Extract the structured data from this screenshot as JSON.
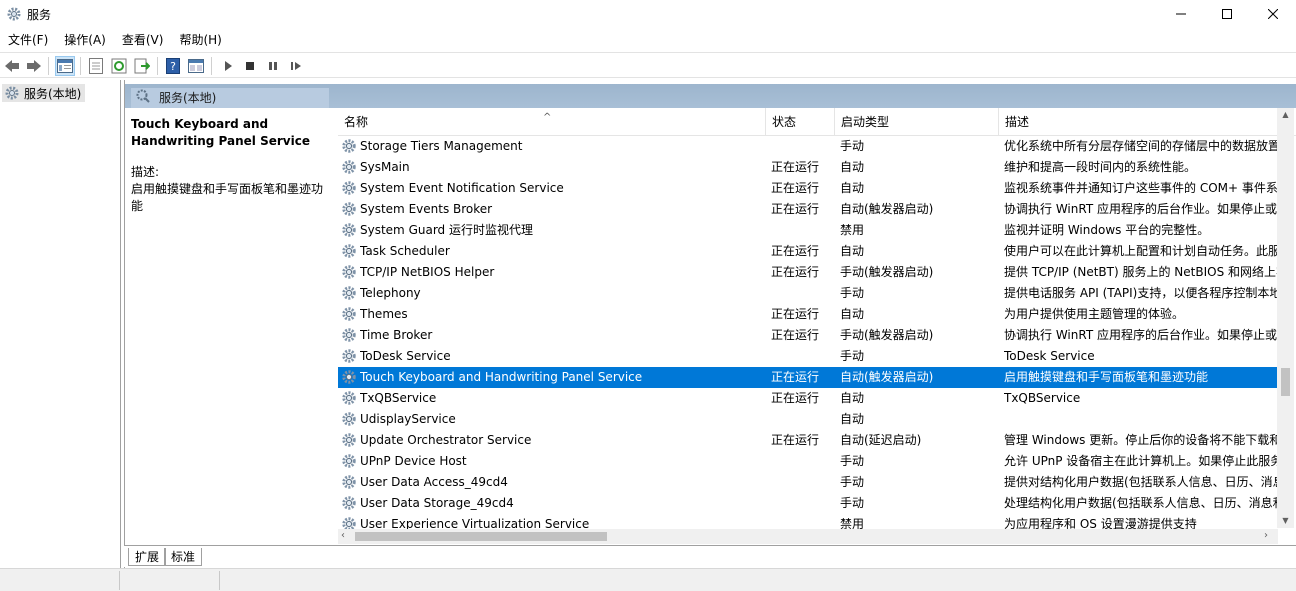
{
  "window": {
    "title": "服务"
  },
  "menu": [
    "文件(F)",
    "操作(A)",
    "查看(V)",
    "帮助(H)"
  ],
  "tree": {
    "root": "服务(本地)"
  },
  "panel": {
    "header": "服务(本地)"
  },
  "details": {
    "service_name": "Touch Keyboard and Handwriting Panel Service",
    "description_label": "描述:",
    "description": "启用触摸键盘和手写面板笔和墨迹功能"
  },
  "columns": {
    "name": "名称",
    "status": "状态",
    "startup": "启动类型",
    "description": "描述"
  },
  "services": [
    {
      "name": "Storage Tiers Management",
      "status": "",
      "startup": "手动",
      "description": "优化系统中所有分层存储空间的存储层中的数据放置"
    },
    {
      "name": "SysMain",
      "status": "正在运行",
      "startup": "自动",
      "description": "维护和提高一段时间内的系统性能。"
    },
    {
      "name": "System Event Notification Service",
      "status": "正在运行",
      "startup": "自动",
      "description": "监视系统事件并通知订户这些事件的 COM+ 事件系"
    },
    {
      "name": "System Events Broker",
      "status": "正在运行",
      "startup": "自动(触发器启动)",
      "description": "协调执行 WinRT 应用程序的后台作业。如果停止或"
    },
    {
      "name": "System Guard 运行时监视代理",
      "status": "",
      "startup": "禁用",
      "description": "监视并证明 Windows 平台的完整性。"
    },
    {
      "name": "Task Scheduler",
      "status": "正在运行",
      "startup": "自动",
      "description": "使用户可以在此计算机上配置和计划自动任务。此服"
    },
    {
      "name": "TCP/IP NetBIOS Helper",
      "status": "正在运行",
      "startup": "手动(触发器启动)",
      "description": "提供 TCP/IP (NetBT) 服务上的 NetBIOS 和网络上客"
    },
    {
      "name": "Telephony",
      "status": "",
      "startup": "手动",
      "description": "提供电话服务 API (TAPI)支持，以便各程序控制本地"
    },
    {
      "name": "Themes",
      "status": "正在运行",
      "startup": "自动",
      "description": "为用户提供使用主题管理的体验。"
    },
    {
      "name": "Time Broker",
      "status": "正在运行",
      "startup": "手动(触发器启动)",
      "description": "协调执行 WinRT 应用程序的后台作业。如果停止或"
    },
    {
      "name": "ToDesk Service",
      "status": "",
      "startup": "手动",
      "description": "ToDesk Service"
    },
    {
      "name": "Touch Keyboard and Handwriting Panel Service",
      "status": "正在运行",
      "startup": "自动(触发器启动)",
      "description": "启用触摸键盘和手写面板笔和墨迹功能",
      "selected": true
    },
    {
      "name": "TxQBService",
      "status": "正在运行",
      "startup": "自动",
      "description": "TxQBService"
    },
    {
      "name": "UdisplayService",
      "status": "",
      "startup": "自动",
      "description": ""
    },
    {
      "name": "Update Orchestrator Service",
      "status": "正在运行",
      "startup": "自动(延迟启动)",
      "description": "管理 Windows 更新。停止后你的设备将不能下载和"
    },
    {
      "name": "UPnP Device Host",
      "status": "",
      "startup": "手动",
      "description": "允许 UPnP 设备宿主在此计算机上。如果停止此服务"
    },
    {
      "name": "User Data Access_49cd4",
      "status": "",
      "startup": "手动",
      "description": "提供对结构化用户数据(包括联系人信息、日历、消息"
    },
    {
      "name": "User Data Storage_49cd4",
      "status": "",
      "startup": "手动",
      "description": "处理结构化用户数据(包括联系人信息、日历、消息和"
    },
    {
      "name": "User Experience Virtualization Service",
      "status": "",
      "startup": "禁用",
      "description": "为应用程序和 OS 设置漫游提供支持"
    }
  ],
  "tabs": [
    "扩展",
    "标准"
  ],
  "colors": {
    "selection": "#0078d7",
    "header_band": "#a8bfd6"
  }
}
